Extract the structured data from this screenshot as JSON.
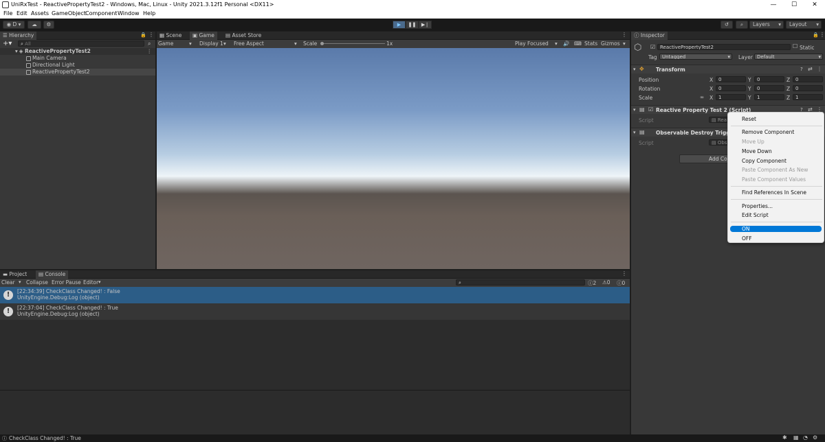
{
  "window": {
    "title": "UniRxTest - ReactivePropertyTest2 - Windows, Mac, Linux - Unity 2021.3.12f1 Personal <DX11>",
    "min": "—",
    "max": "☐",
    "close": "✕"
  },
  "menu": [
    "File",
    "Edit",
    "Assets",
    "GameObject",
    "Component",
    "Window",
    "Help"
  ],
  "toolbar": {
    "account": "D",
    "layers": "Layers",
    "layout": "Layout"
  },
  "hierarchy": {
    "tab": "Hierarchy",
    "search_placeholder": "All",
    "scene": "ReactivePropertyTest2",
    "items": [
      "Main Camera",
      "Directional Light",
      "ReactivePropertyTest2"
    ]
  },
  "game": {
    "tabs": [
      "Scene",
      "Game",
      "Asset Store"
    ],
    "mode": "Game",
    "display": "Display 1",
    "aspect": "Free Aspect",
    "scale_label": "Scale",
    "scale_value": "1x",
    "play_focused": "Play Focused",
    "stats": "Stats",
    "gizmos": "Gizmos"
  },
  "inspector": {
    "tab": "Inspector",
    "object_name": "ReactivePropertyTest2",
    "static": "Static",
    "tag_label": "Tag",
    "tag_value": "Untagged",
    "layer_label": "Layer",
    "layer_value": "Default",
    "transform": {
      "title": "Transform",
      "rows": [
        {
          "label": "Position",
          "x": "0",
          "y": "0",
          "z": "0"
        },
        {
          "label": "Rotation",
          "x": "0",
          "y": "0",
          "z": "0"
        },
        {
          "label": "Scale",
          "x": "1",
          "y": "1",
          "z": "1"
        }
      ]
    },
    "component1": {
      "title": "Reactive Property Test 2 (Script)",
      "script_label": "Script",
      "script_value": "Rea"
    },
    "component2": {
      "title": "Observable Destroy Trigge",
      "script_label": "Script",
      "script_value": "Obs"
    },
    "add_component": "Add Co"
  },
  "context_menu": {
    "items": [
      {
        "label": "Reset",
        "disabled": false
      },
      {
        "label": "Remove Component",
        "disabled": false
      },
      {
        "label": "Move Up",
        "disabled": true
      },
      {
        "label": "Move Down",
        "disabled": false
      },
      {
        "label": "Copy Component",
        "disabled": false
      },
      {
        "label": "Paste Component As New",
        "disabled": true
      },
      {
        "label": "Paste Component Values",
        "disabled": true
      },
      {
        "label": "Find References In Scene",
        "disabled": false
      },
      {
        "label": "Properties...",
        "disabled": false
      },
      {
        "label": "Edit Script",
        "disabled": false
      },
      {
        "label": "ON",
        "disabled": false
      },
      {
        "label": "OFF",
        "disabled": false
      }
    ]
  },
  "console": {
    "tabs": [
      "Project",
      "Console"
    ],
    "clear": "Clear",
    "collapse": "Collapse",
    "error_pause": "Error Pause",
    "editor": "Editor",
    "counts": {
      "logs": "2",
      "warnings": "0",
      "errors": "0"
    },
    "entries": [
      {
        "line1": "[22:34:39] CheckClass Changed! : False",
        "line2": "UnityEngine.Debug:Log (object)"
      },
      {
        "line1": "[22:37:04] CheckClass Changed! : True",
        "line2": "UnityEngine.Debug:Log (object)"
      }
    ]
  },
  "status": {
    "message": "CheckClass Changed! : True"
  },
  "colors": {
    "selection": "#2c5d87",
    "menu_highlight": "#0078d7",
    "panel": "#383838"
  }
}
